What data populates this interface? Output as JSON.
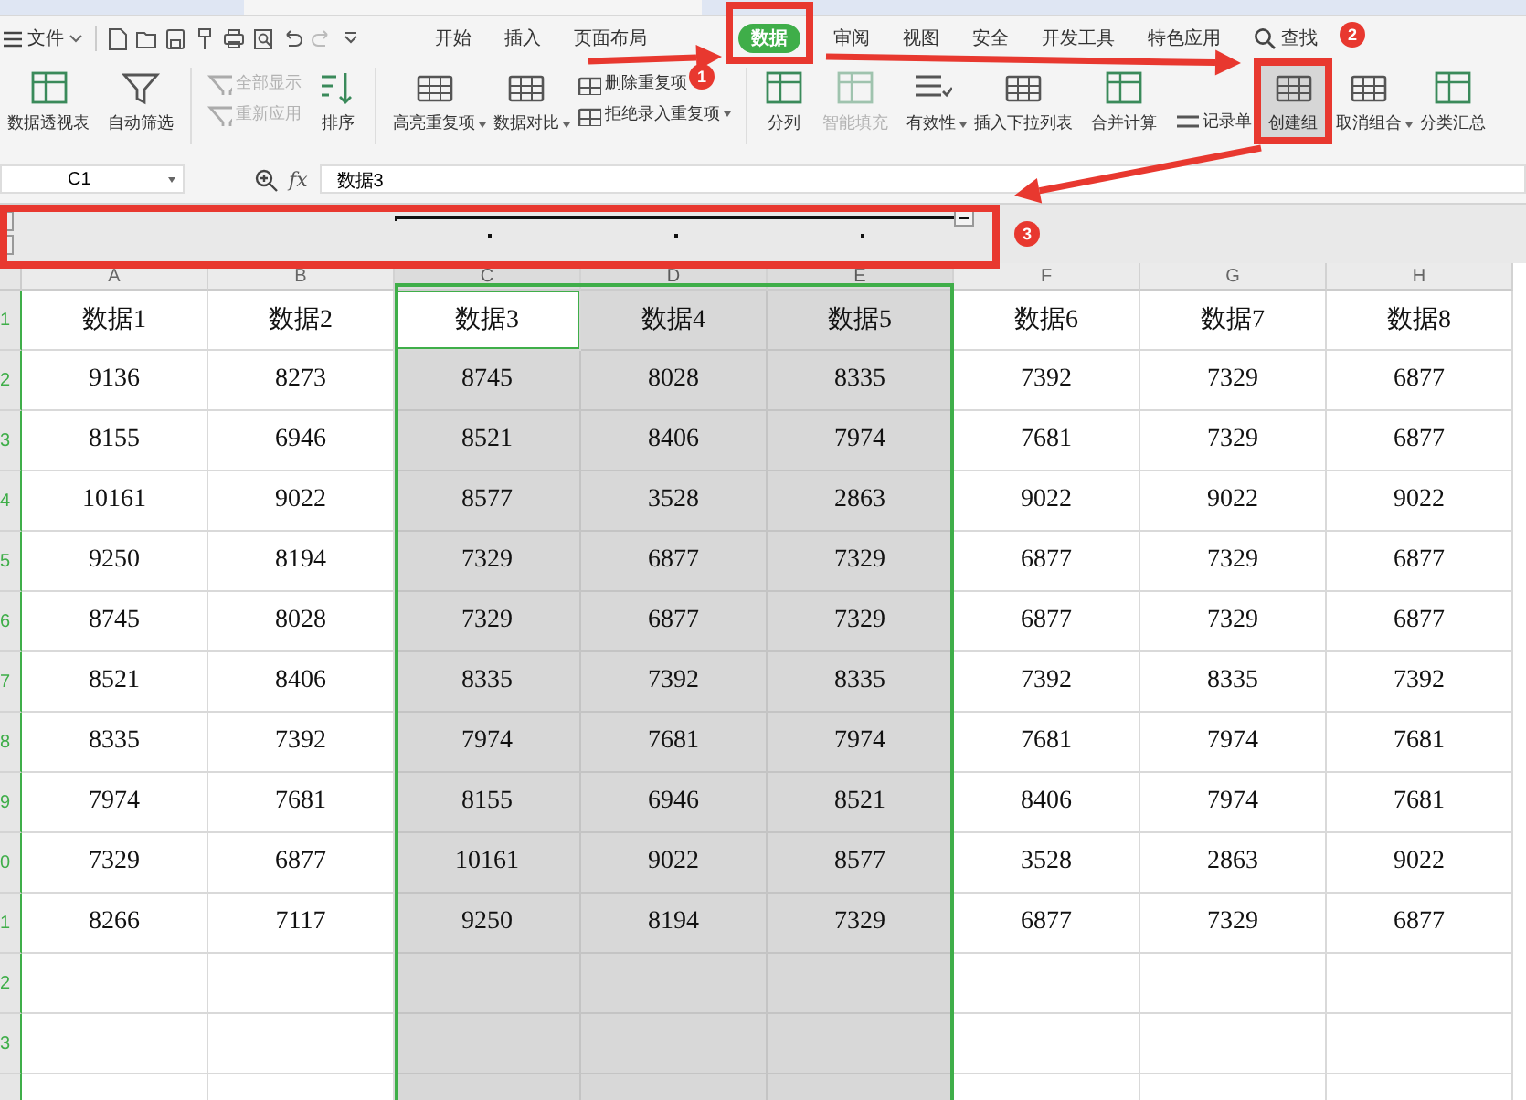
{
  "menu": {
    "file": "文件",
    "tabs": [
      {
        "label": "开始",
        "selected": false,
        "kind": "tab"
      },
      {
        "label": "插入",
        "selected": false,
        "kind": "tab"
      },
      {
        "label": "页面布局",
        "selected": false,
        "kind": "tab"
      },
      {
        "label": "数据",
        "selected": true,
        "kind": "tab"
      },
      {
        "label": "审阅",
        "selected": false,
        "kind": "tab"
      },
      {
        "label": "视图",
        "selected": false,
        "kind": "tab"
      },
      {
        "label": "安全",
        "selected": false,
        "kind": "tab"
      },
      {
        "label": "开发工具",
        "selected": false,
        "kind": "tab"
      },
      {
        "label": "特色应用",
        "selected": false,
        "kind": "tab"
      },
      {
        "label": "查找",
        "selected": false,
        "kind": "search"
      }
    ]
  },
  "ribbon": [
    {
      "kind": "large",
      "items": [
        {
          "label": "数据透视表",
          "disabled": false,
          "dropdown": false,
          "selected": false
        }
      ]
    },
    {
      "kind": "large",
      "items": [
        {
          "label": "自动筛选",
          "disabled": false,
          "dropdown": false,
          "selected": false
        }
      ]
    },
    {
      "kind": "stack",
      "items": [
        {
          "label": "全部显示",
          "disabled": true,
          "dropdown": false,
          "selected": false
        },
        {
          "label": "重新应用",
          "disabled": true,
          "dropdown": false,
          "selected": false
        }
      ]
    },
    {
      "kind": "sort",
      "items": [
        {
          "label": "排序",
          "disabled": false,
          "dropdown": false,
          "selected": false
        }
      ]
    },
    {
      "kind": "large",
      "items": [
        {
          "label": "高亮重复项",
          "disabled": false,
          "dropdown": true,
          "selected": false
        }
      ]
    },
    {
      "kind": "large",
      "items": [
        {
          "label": "数据对比",
          "disabled": false,
          "dropdown": true,
          "selected": false
        }
      ]
    },
    {
      "kind": "stack",
      "items": [
        {
          "label": "删除重复项",
          "disabled": false,
          "dropdown": false,
          "selected": false
        },
        {
          "label": "拒绝录入重复项",
          "disabled": false,
          "dropdown": true,
          "selected": false
        }
      ]
    },
    {
      "kind": "large",
      "items": [
        {
          "label": "分列",
          "disabled": false,
          "dropdown": false,
          "selected": false
        }
      ]
    },
    {
      "kind": "large",
      "items": [
        {
          "label": "智能填充",
          "disabled": true,
          "dropdown": false,
          "selected": false
        }
      ]
    },
    {
      "kind": "large",
      "items": [
        {
          "label": "有效性",
          "disabled": false,
          "dropdown": true,
          "selected": false
        }
      ]
    },
    {
      "kind": "large",
      "items": [
        {
          "label": "插入下拉列表",
          "disabled": false,
          "dropdown": false,
          "selected": false
        }
      ]
    },
    {
      "kind": "large",
      "items": [
        {
          "label": "合并计算",
          "disabled": false,
          "dropdown": false,
          "selected": false
        }
      ]
    },
    {
      "kind": "stack",
      "items": [
        {
          "label": "记录单",
          "disabled": false,
          "dropdown": false,
          "selected": false
        }
      ]
    },
    {
      "kind": "large",
      "items": [
        {
          "label": "创建组",
          "disabled": false,
          "dropdown": false,
          "selected": true
        }
      ]
    },
    {
      "kind": "large",
      "items": [
        {
          "label": "取消组合",
          "disabled": false,
          "dropdown": true,
          "selected": false
        }
      ]
    },
    {
      "kind": "large",
      "items": [
        {
          "label": "分类汇总",
          "disabled": false,
          "dropdown": false,
          "selected": false
        }
      ]
    }
  ],
  "formula_bar": {
    "name_box": "C1",
    "fx": "fx",
    "value": "数据3"
  },
  "sheet": {
    "columns": [
      {
        "label": "A",
        "selected": false,
        "active": false
      },
      {
        "label": "B",
        "selected": false,
        "active": false
      },
      {
        "label": "C",
        "selected": true,
        "active": true
      },
      {
        "label": "D",
        "selected": true,
        "active": false
      },
      {
        "label": "E",
        "selected": true,
        "active": false
      },
      {
        "label": "F",
        "selected": false,
        "active": false
      },
      {
        "label": "G",
        "selected": false,
        "active": false
      },
      {
        "label": "H",
        "selected": false,
        "active": false
      }
    ],
    "rows": [
      {
        "number": "1",
        "has_active_cell": true,
        "cells": [
          "数据1",
          "数据2",
          "数据3",
          "数据4",
          "数据5",
          "数据6",
          "数据7",
          "数据8"
        ]
      },
      {
        "number": "2",
        "has_active_cell": false,
        "cells": [
          "9136",
          "8273",
          "8745",
          "8028",
          "8335",
          "7392",
          "7329",
          "6877"
        ]
      },
      {
        "number": "3",
        "has_active_cell": false,
        "cells": [
          "8155",
          "6946",
          "8521",
          "8406",
          "7974",
          "7681",
          "7329",
          "6877"
        ]
      },
      {
        "number": "4",
        "has_active_cell": false,
        "cells": [
          "10161",
          "9022",
          "8577",
          "3528",
          "2863",
          "9022",
          "9022",
          "9022"
        ]
      },
      {
        "number": "5",
        "has_active_cell": false,
        "cells": [
          "9250",
          "8194",
          "7329",
          "6877",
          "7329",
          "6877",
          "7329",
          "6877"
        ]
      },
      {
        "number": "6",
        "has_active_cell": false,
        "cells": [
          "8745",
          "8028",
          "7329",
          "6877",
          "7329",
          "6877",
          "7329",
          "6877"
        ]
      },
      {
        "number": "7",
        "has_active_cell": false,
        "cells": [
          "8521",
          "8406",
          "8335",
          "7392",
          "8335",
          "7392",
          "8335",
          "7392"
        ]
      },
      {
        "number": "8",
        "has_active_cell": false,
        "cells": [
          "8335",
          "7392",
          "7974",
          "7681",
          "7974",
          "7681",
          "7974",
          "7681"
        ]
      },
      {
        "number": "9",
        "has_active_cell": false,
        "cells": [
          "7974",
          "7681",
          "8155",
          "6946",
          "8521",
          "8406",
          "7974",
          "7681"
        ]
      },
      {
        "number": "0",
        "has_active_cell": false,
        "cells": [
          "7329",
          "6877",
          "10161",
          "9022",
          "8577",
          "3528",
          "2863",
          "9022"
        ]
      },
      {
        "number": "1",
        "has_active_cell": false,
        "cells": [
          "8266",
          "7117",
          "9250",
          "8194",
          "7329",
          "6877",
          "7329",
          "6877"
        ]
      },
      {
        "number": "2",
        "has_active_cell": false,
        "cells": []
      },
      {
        "number": "3",
        "has_active_cell": false,
        "cells": []
      },
      {
        "has_active_cell": false,
        "cells": []
      }
    ]
  },
  "annotations": [
    {
      "label": "1"
    },
    {
      "label": "2"
    },
    {
      "label": "3"
    }
  ]
}
